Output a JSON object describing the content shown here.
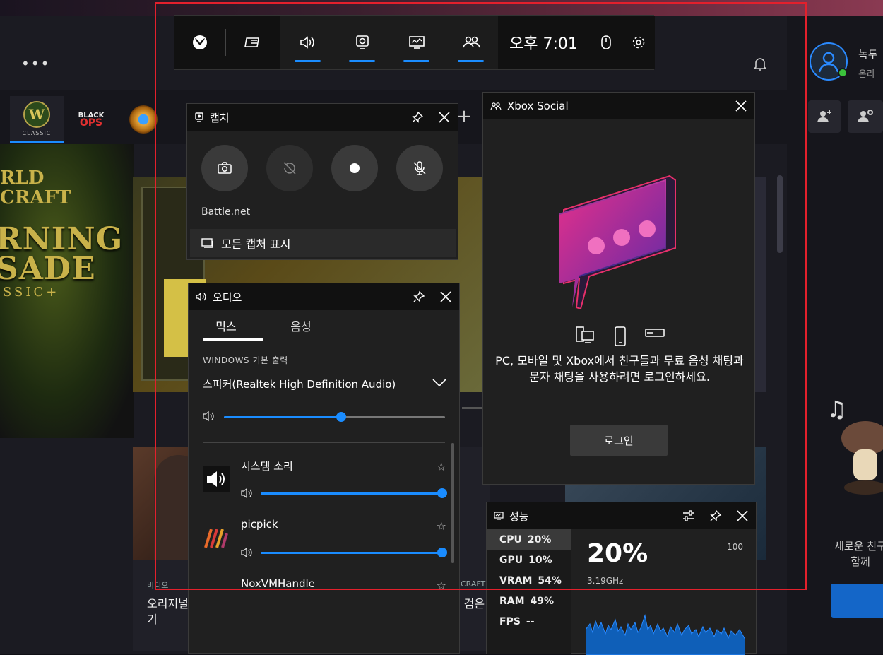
{
  "launcher": {
    "menu_dots": "•••",
    "tabs": {
      "wow": {
        "badge": "W",
        "small": "CLASSIC"
      },
      "black_ops": {
        "line1": "BLACK",
        "line2": "OPS"
      }
    },
    "wow_art": {
      "logo_top": "RLD\nCRAFT",
      "line1": "RNING",
      "line2": "SADE",
      "classic": "SSIC+"
    },
    "cards": {
      "video_label": "비디오",
      "video_title": "오리지널 검은 사원 트레일러 돌아보기",
      "guide_title": "마이에브가 알려주는 검은 사원 공격대 가이드",
      "guide_label": "CRAFT"
    },
    "user": {
      "name": "녹두",
      "status": "온라"
    },
    "new_friend": "새로운 친구\n함께"
  },
  "game_bar": {
    "time": "오후 7:01",
    "icons": [
      "xbox-icon",
      "widget-menu-icon",
      "audio-icon",
      "capture-icon",
      "performance-icon",
      "social-icon",
      "mouse-icon",
      "settings-icon"
    ]
  },
  "capture": {
    "title": "캡처",
    "source": "Battle.net",
    "show_all": "모든 캡처 표시"
  },
  "audio": {
    "title": "오디오",
    "tabs": [
      "믹스",
      "음성"
    ],
    "section": "WINDOWS 기본 출력",
    "device": "스피커(Realtek High Definition Audio)",
    "master_volume": 0.53,
    "apps": [
      {
        "name": "시스템 소리",
        "volume": 1.0
      },
      {
        "name": "picpick",
        "volume": 1.0
      },
      {
        "name": "NoxVMHandle",
        "volume": 1.0
      }
    ]
  },
  "social": {
    "title": "Xbox Social",
    "message": "PC, 모바일 및 Xbox에서 친구들과 무료 음성 채팅과 문자 채팅을 사용하려면 로그인하세요.",
    "login": "로그인"
  },
  "performance": {
    "title": "성능",
    "metrics": [
      {
        "label": "CPU",
        "value": "20%"
      },
      {
        "label": "GPU",
        "value": "10%"
      },
      {
        "label": "VRAM",
        "value": "54%"
      },
      {
        "label": "RAM",
        "value": "49%"
      },
      {
        "label": "FPS",
        "value": "--"
      }
    ],
    "big_value": "20%",
    "max": "100",
    "freq": "3.19GHz"
  },
  "colors": {
    "accent": "#1a8cff",
    "highlight": "#e3202c"
  }
}
